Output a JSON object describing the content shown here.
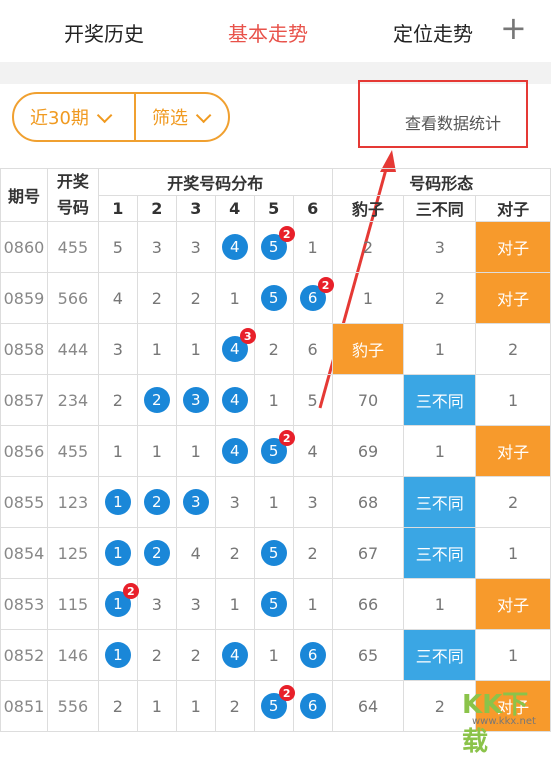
{
  "tabs": [
    {
      "label": "开奖历史"
    },
    {
      "label": "基本走势"
    },
    {
      "label": "定位走势"
    }
  ],
  "add_label": "+",
  "filters": {
    "period": "近30期",
    "filter": "筛选"
  },
  "stats_link": "查看数据统计",
  "colors": {
    "accent": "#e8524a",
    "pill": "#f0a030",
    "ball": "#1a87d8",
    "orange": "#f79a2c",
    "blue": "#3aa6e4"
  },
  "table": {
    "headers": {
      "period": "期号",
      "number": "开奖\n号码",
      "distribution": "开奖号码分布",
      "shape": "号码形态",
      "cols": [
        "1",
        "2",
        "3",
        "4",
        "5",
        "6"
      ],
      "shape_cols": [
        "豹子",
        "三不同",
        "对子"
      ]
    },
    "rows": [
      {
        "period": "0860",
        "number": "455",
        "dist": [
          "5",
          "3",
          "3",
          "4",
          "5",
          "1"
        ],
        "balls": [
          false,
          false,
          false,
          true,
          true,
          false
        ],
        "badges": [
          "",
          "",
          "",
          "",
          "2",
          ""
        ],
        "leopard": "2",
        "diff": "3",
        "pair": "对子",
        "highlight": "pair"
      },
      {
        "period": "0859",
        "number": "566",
        "dist": [
          "4",
          "2",
          "2",
          "1",
          "5",
          "6"
        ],
        "balls": [
          false,
          false,
          false,
          false,
          true,
          true
        ],
        "badges": [
          "",
          "",
          "",
          "",
          "",
          "2"
        ],
        "leopard": "1",
        "diff": "2",
        "pair": "对子",
        "highlight": "pair"
      },
      {
        "period": "0858",
        "number": "444",
        "dist": [
          "3",
          "1",
          "1",
          "4",
          "2",
          "6"
        ],
        "balls": [
          false,
          false,
          false,
          true,
          false,
          false
        ],
        "badges": [
          "",
          "",
          "",
          "3",
          "",
          ""
        ],
        "leopard": "豹子",
        "diff": "1",
        "pair": "2",
        "highlight": "leopard"
      },
      {
        "period": "0857",
        "number": "234",
        "dist": [
          "2",
          "2",
          "3",
          "4",
          "1",
          "5"
        ],
        "balls": [
          false,
          true,
          true,
          true,
          false,
          false
        ],
        "badges": [
          "",
          "",
          "",
          "",
          "",
          ""
        ],
        "leopard": "70",
        "diff": "三不同",
        "pair": "1",
        "highlight": "diff"
      },
      {
        "period": "0856",
        "number": "455",
        "dist": [
          "1",
          "1",
          "1",
          "4",
          "5",
          "4"
        ],
        "balls": [
          false,
          false,
          false,
          true,
          true,
          false
        ],
        "badges": [
          "",
          "",
          "",
          "",
          "2",
          ""
        ],
        "leopard": "69",
        "diff": "1",
        "pair": "对子",
        "highlight": "pair"
      },
      {
        "period": "0855",
        "number": "123",
        "dist": [
          "1",
          "2",
          "3",
          "3",
          "1",
          "3"
        ],
        "balls": [
          true,
          true,
          true,
          false,
          false,
          false
        ],
        "badges": [
          "",
          "",
          "",
          "",
          "",
          ""
        ],
        "leopard": "68",
        "diff": "三不同",
        "pair": "2",
        "highlight": "diff"
      },
      {
        "period": "0854",
        "number": "125",
        "dist": [
          "1",
          "2",
          "4",
          "2",
          "5",
          "2"
        ],
        "balls": [
          true,
          true,
          false,
          false,
          true,
          false
        ],
        "badges": [
          "",
          "",
          "",
          "",
          "",
          ""
        ],
        "leopard": "67",
        "diff": "三不同",
        "pair": "1",
        "highlight": "diff"
      },
      {
        "period": "0853",
        "number": "115",
        "dist": [
          "1",
          "3",
          "3",
          "1",
          "5",
          "1"
        ],
        "balls": [
          true,
          false,
          false,
          false,
          true,
          false
        ],
        "badges": [
          "2",
          "",
          "",
          "",
          "",
          ""
        ],
        "leopard": "66",
        "diff": "1",
        "pair": "对子",
        "highlight": "pair"
      },
      {
        "period": "0852",
        "number": "146",
        "dist": [
          "1",
          "2",
          "2",
          "4",
          "1",
          "6"
        ],
        "balls": [
          true,
          false,
          false,
          true,
          false,
          true
        ],
        "badges": [
          "",
          "",
          "",
          "",
          "",
          ""
        ],
        "leopard": "65",
        "diff": "三不同",
        "pair": "1",
        "highlight": "diff"
      },
      {
        "period": "0851",
        "number": "556",
        "dist": [
          "2",
          "1",
          "1",
          "2",
          "5",
          "6"
        ],
        "balls": [
          false,
          false,
          false,
          false,
          true,
          true
        ],
        "badges": [
          "",
          "",
          "",
          "",
          "2",
          ""
        ],
        "leopard": "64",
        "diff": "2",
        "pair": "对子",
        "highlight": "pair"
      }
    ]
  },
  "watermark": {
    "text": "KK下载",
    "url": "www.kkx.net"
  }
}
